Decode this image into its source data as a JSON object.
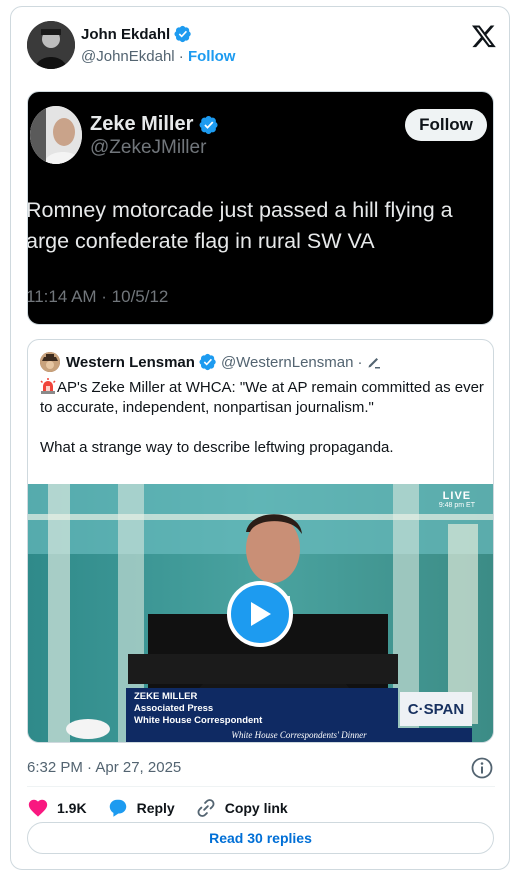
{
  "author": {
    "name": "John Ekdahl",
    "handle": "@JohnEkdahl",
    "separator": " · ",
    "follow": "Follow"
  },
  "embedded_screenshot": {
    "name": "Zeke Miller",
    "handle": "@ZekeJMiller",
    "follow": "Follow",
    "text": "Romney motorcade just passed a hill flying a\narge confederate flag in rural SW VA",
    "time": "11:14 AM · 10/5/12"
  },
  "quote": {
    "name": "Western Lensman",
    "handle": "@WesternLensman",
    "separator": "·",
    "para1": "AP's Zeke Miller at WHCA: \"We at AP remain committed as ever to accurate, independent, nonpartisan journalism.\"",
    "para2": "What a strange way to describe leftwing propaganda.",
    "video": {
      "live": "LIVE",
      "live_time": "9:48 pm ET",
      "lower_third": [
        "ZEKE MILLER",
        "Associated Press",
        "White House Correspondent"
      ],
      "network": "C·SPAN",
      "banner": "White House Correspondents' Dinner"
    }
  },
  "timestamp": "6:32 PM · Apr 27, 2025",
  "actions": {
    "likes": "1.9K",
    "reply": "Reply",
    "copy_link": "Copy link"
  },
  "read_replies": "Read 30 replies",
  "colors": {
    "accent": "#1d9bf0",
    "like": "#f91880",
    "text_secondary": "#536471",
    "border": "#cfd9de"
  }
}
